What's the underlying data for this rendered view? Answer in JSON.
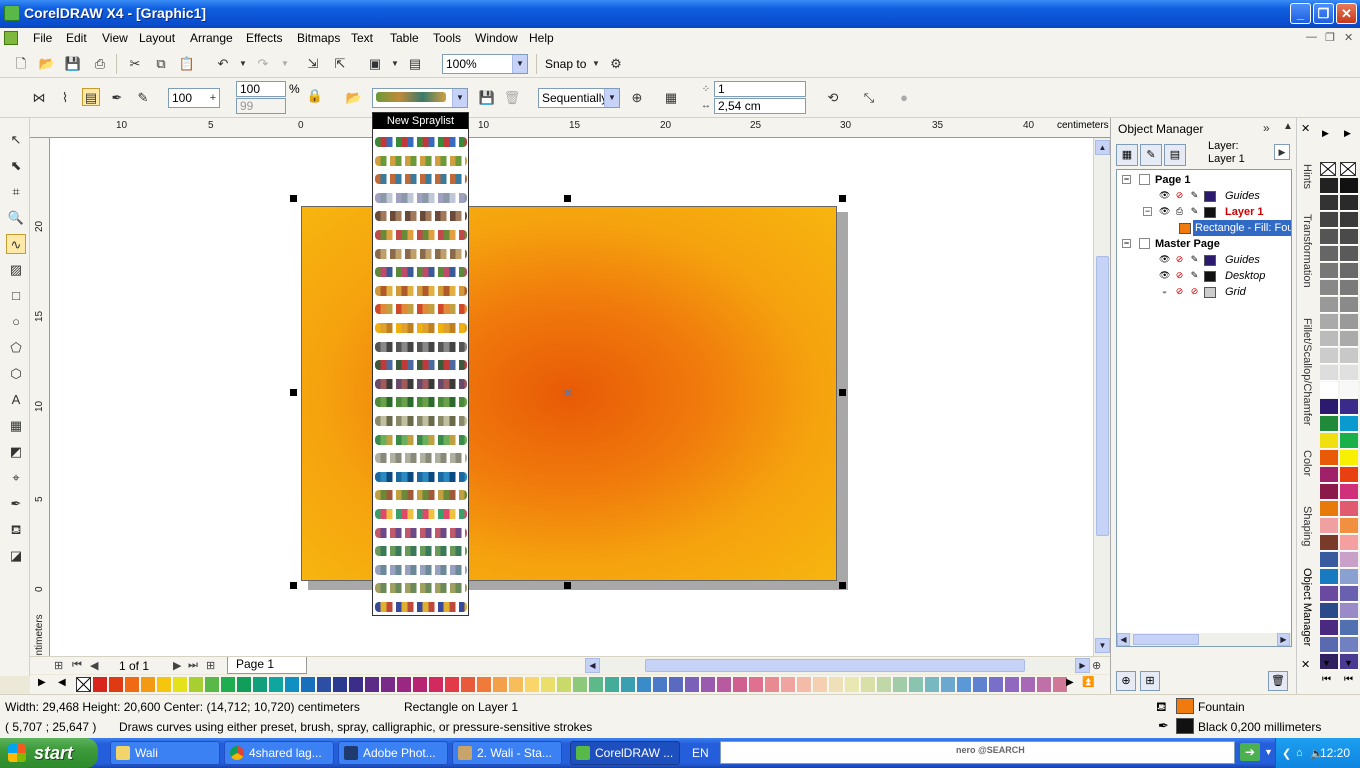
{
  "window": {
    "title": "CorelDRAW X4 - [Graphic1]",
    "min_label": "_",
    "max_label": "❐",
    "close_label": "✕"
  },
  "menu": {
    "items": [
      "File",
      "Edit",
      "View",
      "Layout",
      "Arrange",
      "Effects",
      "Bitmaps",
      "Text",
      "Table",
      "Tools",
      "Window",
      "Help"
    ]
  },
  "toolbar1": {
    "zoom_value": "100%",
    "snap_label": "Snap to"
  },
  "toolbar2": {
    "size_value": "100",
    "opacity_value": "100",
    "opacity_unit": "%",
    "disabled_value": "99",
    "order_value": "Sequentially",
    "count_value": "1",
    "spacing_value": "2,54 cm"
  },
  "spraylist": {
    "header": "New Spraylist"
  },
  "rulers": {
    "top_ticks": [
      "10",
      "5",
      "0",
      "5",
      "10",
      "15",
      "20",
      "25",
      "30",
      "35",
      "40"
    ],
    "left_ticks": [
      "20",
      "15",
      "10",
      "5",
      "0"
    ],
    "unit": "centimeters"
  },
  "pagebar": {
    "counter": "1 of 1",
    "page_tab": "Page 1"
  },
  "status": {
    "dimensions": "Width: 29,468  Height: 20,600  Center: (14,712; 10,720)  centimeters",
    "object_info": "Rectangle on Layer 1",
    "coordinates": "( 5,707 ; 25,647 )",
    "hint": "Draws curves using either preset, brush, spray, calligraphic, or pressure-sensitive strokes",
    "fill_label": "Fountain",
    "fill_color": "#f07a0c",
    "outline_label": "Black  0,200 millimeters",
    "outline_color": "#111111"
  },
  "object_manager": {
    "title": "Object Manager",
    "layer_label_1": "Layer:",
    "layer_label_2": "Layer 1",
    "tree": {
      "page1": "Page 1",
      "guides1": "Guides",
      "layer1": "Layer 1",
      "rectangle": "Rectangle - Fill: Fou",
      "master": "Master Page",
      "guides2": "Guides",
      "desktop": "Desktop",
      "grid": "Grid"
    }
  },
  "docker_tabs": [
    "Hints",
    "Transformation",
    "Fillet/Scallop/Chamfer",
    "Color",
    "Shaping",
    "Object Manager"
  ],
  "taskbar": {
    "start": "start",
    "tasks": [
      "Wali",
      "4shared lag...",
      "Adobe Phot...",
      "2. Wali - Sta...",
      "CorelDRAW ..."
    ],
    "lang": "EN",
    "nero_brand": "nero @SEARCH",
    "clock": "12:20"
  },
  "colors": {
    "shape_center": "#e85a06",
    "shape_edge": "#f7b50f",
    "titlebar": "#0a4fd0"
  }
}
